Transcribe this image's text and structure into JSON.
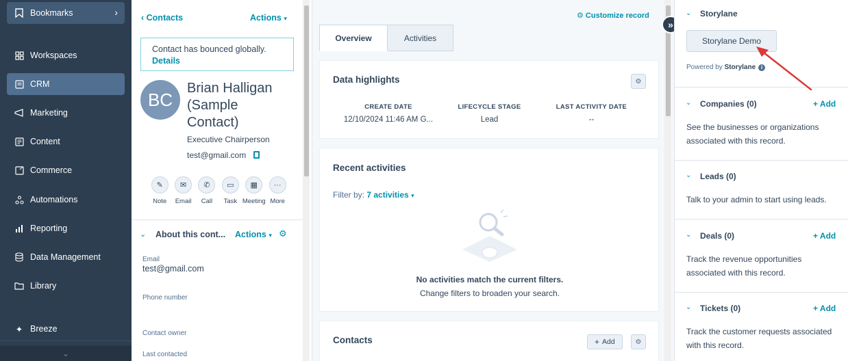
{
  "nav": {
    "bookmarks": "Bookmarks",
    "items": [
      {
        "label": "Workspaces",
        "icon": "workspaces-icon"
      },
      {
        "label": "CRM",
        "icon": "crm-icon"
      },
      {
        "label": "Marketing",
        "icon": "marketing-icon"
      },
      {
        "label": "Content",
        "icon": "content-icon"
      },
      {
        "label": "Commerce",
        "icon": "commerce-icon"
      },
      {
        "label": "Automations",
        "icon": "automations-icon"
      },
      {
        "label": "Reporting",
        "icon": "reporting-icon"
      },
      {
        "label": "Data Management",
        "icon": "data-management-icon"
      },
      {
        "label": "Library",
        "icon": "library-icon"
      }
    ],
    "breeze": "Breeze",
    "active": "CRM"
  },
  "contact": {
    "back_label": "Contacts",
    "actions_label": "Actions",
    "bounce_msg": "Contact has bounced globally.",
    "bounce_details": "Details",
    "initials": "BC",
    "name": "Brian Halligan (Sample Contact)",
    "job_title": "Executive Chairperson",
    "email": "test@gmail.com",
    "actions": [
      "Note",
      "Email",
      "Call",
      "Task",
      "Meeting",
      "More"
    ]
  },
  "about": {
    "title": "About this cont...",
    "actions_label": "Actions",
    "props": [
      {
        "label": "Email",
        "value": "test@gmail.com"
      },
      {
        "label": "Phone number",
        "value": ""
      },
      {
        "label": "Contact owner",
        "value": ""
      },
      {
        "label": "Last contacted",
        "value": ""
      }
    ]
  },
  "middle": {
    "customize": "Customize record",
    "tabs": [
      "Overview",
      "Activities"
    ],
    "highlights": {
      "title": "Data highlights",
      "cols": [
        {
          "head": "CREATE DATE",
          "value": "12/10/2024 11:46 AM G..."
        },
        {
          "head": "LIFECYCLE STAGE",
          "value": "Lead"
        },
        {
          "head": "LAST ACTIVITY DATE",
          "value": "--"
        }
      ]
    },
    "recent": {
      "title": "Recent activities",
      "filter_label": "Filter by:",
      "filter_value": "7 activities",
      "empty_title": "No activities match the current filters.",
      "empty_sub": "Change filters to broaden your search."
    },
    "contacts_card": {
      "title": "Contacts",
      "add": "Add"
    }
  },
  "right": {
    "storylane": {
      "title": "Storylane",
      "button": "Storylane Demo",
      "powered_prefix": "Powered by",
      "powered_brand": "Storylane"
    },
    "sections": [
      {
        "title": "Companies (0)",
        "add": "+ Add",
        "desc": "See the businesses or organizations associated with this record."
      },
      {
        "title": "Leads (0)",
        "add": "",
        "desc": "Talk to your admin to start using leads."
      },
      {
        "title": "Deals (0)",
        "add": "+ Add",
        "desc": "Track the revenue opportunities associated with this record."
      },
      {
        "title": "Tickets (0)",
        "add": "+ Add",
        "desc": "Track the customer requests associated with this record."
      }
    ]
  },
  "colors": {
    "nav_bg": "#2d3e50",
    "accent": "#0091ae",
    "arrow": "#d93a3a"
  }
}
